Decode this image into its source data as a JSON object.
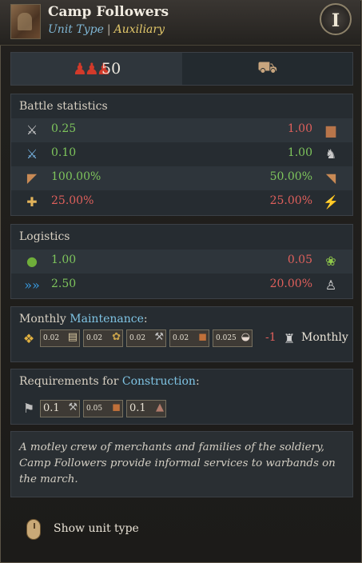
{
  "header": {
    "title": "Camp Followers",
    "unit_type_label": "Unit Type",
    "separator": "|",
    "unit_class": "Auxiliary",
    "info_letter": "I"
  },
  "top_bar": {
    "count": "50",
    "soldiers_icon": "soldiers-icon",
    "wagon_icon": "supply-wagon-icon"
  },
  "battle": {
    "title": "Battle statistics",
    "rows": [
      {
        "left_icon": "melee-attack-icon",
        "left": "0.25",
        "right": "1.00",
        "right_icon": "bricks-icon"
      },
      {
        "left_icon": "charge-icon",
        "left": "0.10",
        "right": "1.00",
        "right_icon": "boot-icon"
      },
      {
        "left_icon": "shield-icon",
        "left": "100.00%",
        "right": "50.00%",
        "right_icon": "locked-shield-icon"
      },
      {
        "left_icon": "injury-icon",
        "left": "25.00%",
        "right": "25.00%",
        "right_icon": "morale-icon"
      }
    ]
  },
  "logistics": {
    "title": "Logistics",
    "rows": [
      {
        "left_icon": "food-sack-icon",
        "left": "1.00",
        "right": "0.05",
        "right_icon": "cabbage-icon"
      },
      {
        "left_icon": "speed-arrows-icon",
        "left": "2.50",
        "right": "20.00%",
        "right_icon": "unrest-icon"
      }
    ]
  },
  "maintenance": {
    "title_prefix": "Monthly ",
    "title_highlight": "Maintenance",
    "title_suffix": ":",
    "resources": [
      {
        "value": "0.02",
        "icon": "scroll-icon"
      },
      {
        "value": "0.02",
        "icon": "food-icon"
      },
      {
        "value": "0.02",
        "icon": "tools-icon"
      },
      {
        "value": "0.02",
        "icon": "leather-icon"
      },
      {
        "value": "0.025",
        "icon": "salt-icon"
      }
    ],
    "delta": "-1",
    "monthly_label": "Monthly"
  },
  "construction": {
    "title_prefix": "Requirements for ",
    "title_highlight": "Construction",
    "title_suffix": ":",
    "items": [
      {
        "value": "0.1",
        "icon": "tools-icon"
      },
      {
        "value": "0.05",
        "icon": "leather-icon"
      },
      {
        "value": "0.1",
        "icon": "camp-icon"
      }
    ]
  },
  "description": "A motley crew of merchants and families of the soldiery, Camp Followers provide informal services to warbands on the march.",
  "footer": {
    "show_label": "Show unit type"
  }
}
